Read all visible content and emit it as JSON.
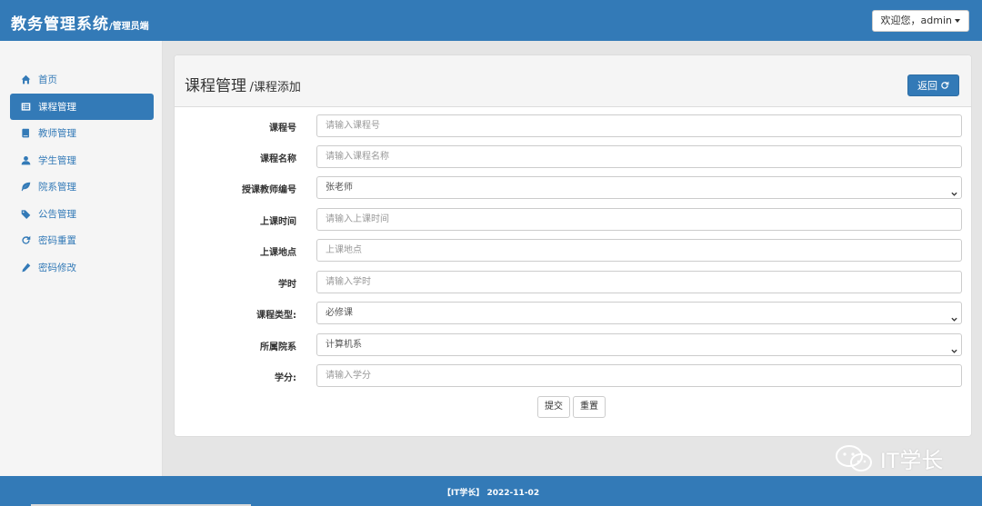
{
  "header": {
    "brand": "教务管理系统",
    "brand_sub": "/管理员端",
    "user_menu_label": "欢迎您，admin"
  },
  "sidebar": {
    "items": [
      {
        "label": "首页",
        "icon": "home-icon",
        "active": false
      },
      {
        "label": "课程管理",
        "icon": "list-icon",
        "active": true
      },
      {
        "label": "教师管理",
        "icon": "book-icon",
        "active": false
      },
      {
        "label": "学生管理",
        "icon": "user-icon",
        "active": false
      },
      {
        "label": "院系管理",
        "icon": "leaf-icon",
        "active": false
      },
      {
        "label": "公告管理",
        "icon": "tags-icon",
        "active": false
      },
      {
        "label": "密码重置",
        "icon": "refresh-icon",
        "active": false
      },
      {
        "label": "密码修改",
        "icon": "pencil-icon",
        "active": false
      }
    ]
  },
  "panel": {
    "title": "课程管理",
    "subtitle": "/课程添加",
    "back_label": "返回"
  },
  "form": {
    "course_id": {
      "label": "课程号",
      "placeholder": "请输入课程号"
    },
    "course_name": {
      "label": "课程名称",
      "placeholder": "请输入课程名称"
    },
    "teacher": {
      "label": "授课教师编号",
      "value": "张老师"
    },
    "class_time": {
      "label": "上课时间",
      "placeholder": "请输入上课时间"
    },
    "class_place": {
      "label": "上课地点",
      "placeholder": "上课地点"
    },
    "hours": {
      "label": "学时",
      "placeholder": "请输入学时"
    },
    "course_type": {
      "label": "课程类型:",
      "value": "必修课"
    },
    "department": {
      "label": "所属院系",
      "value": "计算机系"
    },
    "credit": {
      "label": "学分:",
      "placeholder": "请输入学分"
    },
    "submit_label": "提交",
    "reset_label": "重置"
  },
  "watermark": "IT学长",
  "footer": "【IT学长】 2022-11-02",
  "colors": {
    "primary": "#337ab7",
    "sidebar_bg": "#f5f5f5",
    "page_bg": "#e5e5e5"
  }
}
